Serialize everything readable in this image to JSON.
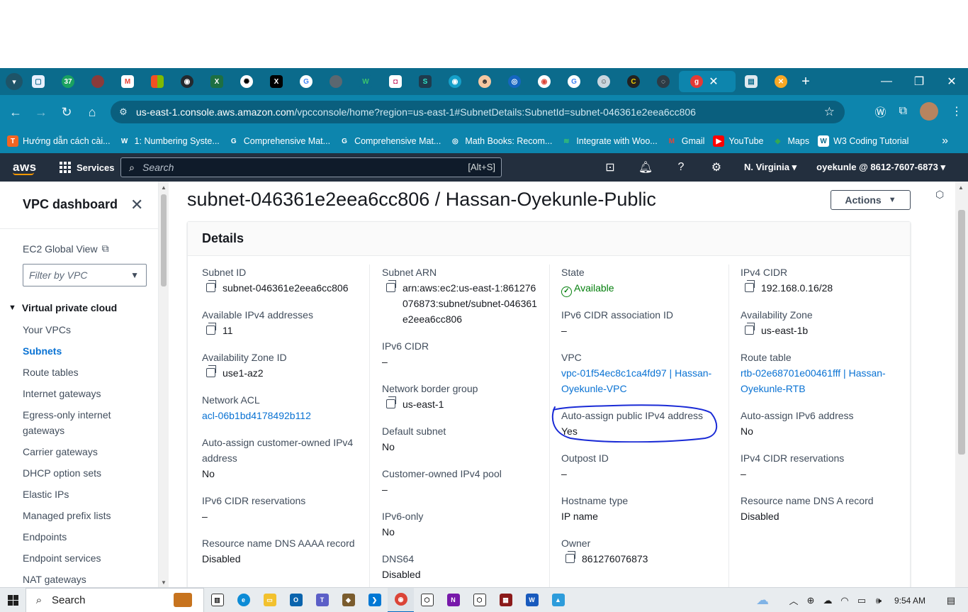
{
  "browser": {
    "tab_icons": [
      "chevron-down-icon",
      "page-icon",
      "counter-37-icon",
      "generic-icon",
      "gmail-icon",
      "microsoft-icon",
      "github-icon",
      "excel-icon",
      "openai-icon",
      "x-icon",
      "google-icon",
      "generic-icon",
      "w-icon",
      "square-icon",
      "s-icon",
      "eye-icon",
      "person-icon",
      "circle-icon",
      "chrome-icon",
      "google-icon",
      "avatar-icon",
      "c-icon",
      "circle-icon",
      "g-icon"
    ],
    "tab_badge_count": "37",
    "url_host": "us-east-1.console.aws.amazon.com",
    "url_path": "/vpcconsole/home?region=us-east-1#SubnetDetails:SubnetId=subnet-046361e2eea6cc806",
    "bookmarks": [
      {
        "label": "Hướng dẫn cách cài...",
        "icon": "T",
        "color": "#f26522"
      },
      {
        "label": "1: Numbering Syste...",
        "icon": "W",
        "color": "#ffffff"
      },
      {
        "label": "Comprehensive Mat...",
        "icon": "G",
        "color": "#ffffff"
      },
      {
        "label": "Comprehensive Mat...",
        "icon": "G",
        "color": "#ffffff"
      },
      {
        "label": "Math Books: Recom...",
        "icon": "◎",
        "color": "#ffffff"
      },
      {
        "label": "Integrate with Woo...",
        "icon": "≋",
        "color": "#3ac46e"
      },
      {
        "label": "Gmail",
        "icon": "M",
        "color": "#ea4335"
      },
      {
        "label": "YouTube",
        "icon": "▶",
        "color": "#ff0000"
      },
      {
        "label": "Maps",
        "icon": "◆",
        "color": "#34a853"
      },
      {
        "label": "W3 Coding Tutorial",
        "icon": "W",
        "color": "#ffffff"
      }
    ]
  },
  "aws": {
    "logo": "aws",
    "services_label": "Services",
    "search_placeholder": "Search",
    "search_shortcut": "[Alt+S]",
    "region": "N. Virginia",
    "account": "oyekunle @ 8612-7607-6873"
  },
  "sidebar": {
    "title": "VPC dashboard",
    "ec2_global_view": "EC2 Global View",
    "filter_placeholder": "Filter by VPC",
    "section": "Virtual private cloud",
    "items": [
      "Your VPCs",
      "Subnets",
      "Route tables",
      "Internet gateways",
      "Egress-only internet gateways",
      "Carrier gateways",
      "DHCP option sets",
      "Elastic IPs",
      "Managed prefix lists",
      "Endpoints",
      "Endpoint services",
      "NAT gateways"
    ],
    "active_item": "Subnets"
  },
  "main": {
    "title": "subnet-046361e2eea6cc806 / Hassan-Oyekunle-Public",
    "actions_label": "Actions",
    "details_header": "Details",
    "columns": [
      [
        {
          "label": "Subnet ID",
          "value": "subnet-046361e2eea6cc806",
          "copy": true
        },
        {
          "label": "Available IPv4 addresses",
          "value": "11",
          "copy": true
        },
        {
          "label": "Availability Zone ID",
          "value": "use1-az2",
          "copy": true
        },
        {
          "label": "Network ACL",
          "value": "acl-06b1bd4178492b112",
          "link": true
        },
        {
          "label": "Auto-assign customer-owned IPv4 address",
          "value": "No"
        },
        {
          "label": "IPv6 CIDR reservations",
          "value": "–"
        },
        {
          "label": "Resource name DNS AAAA record",
          "value": "Disabled"
        }
      ],
      [
        {
          "label": "Subnet ARN",
          "value": "arn:aws:ec2:us-east-1:861276076873:subnet/subnet-046361e2eea6cc806",
          "copy": true
        },
        {
          "label": "IPv6 CIDR",
          "value": "–"
        },
        {
          "label": "Network border group",
          "value": "us-east-1",
          "copy": true
        },
        {
          "label": "Default subnet",
          "value": "No"
        },
        {
          "label": "Customer-owned IPv4 pool",
          "value": "–"
        },
        {
          "label": "IPv6-only",
          "value": "No"
        },
        {
          "label": "DNS64",
          "value": "Disabled"
        }
      ],
      [
        {
          "label": "State",
          "value": "Available",
          "status": true
        },
        {
          "label": "IPv6 CIDR association ID",
          "value": "–"
        },
        {
          "label": "VPC",
          "value": "vpc-01f54ec8c1ca4fd97 | Hassan-Oyekunle-VPC",
          "link": true
        },
        {
          "label": "Auto-assign public IPv4 address",
          "value": "Yes"
        },
        {
          "label": "Outpost ID",
          "value": "–"
        },
        {
          "label": "Hostname type",
          "value": "IP name"
        },
        {
          "label": "Owner",
          "value": "861276076873",
          "copy": true
        }
      ],
      [
        {
          "label": "IPv4 CIDR",
          "value": "192.168.0.16/28",
          "copy": true
        },
        {
          "label": "Availability Zone",
          "value": "us-east-1b",
          "copy": true
        },
        {
          "label": "Route table",
          "value": "rtb-02e68701e00461fff | Hassan-Oyekunle-RTB",
          "link": true
        },
        {
          "label": "Auto-assign IPv6 address",
          "value": "No"
        },
        {
          "label": "IPv4 CIDR reservations",
          "value": "–"
        },
        {
          "label": "Resource name DNS A record",
          "value": "Disabled"
        }
      ]
    ]
  },
  "taskbar": {
    "search_label": "Search",
    "time": "9:54 AM"
  },
  "colors": {
    "browser_tabstrip": "#0b6b8c",
    "browser_toolbar": "#0d85ad",
    "aws_header": "#232f3e",
    "link": "#0972d3",
    "success": "#037f0c",
    "annotation": "#1a2bd6"
  }
}
